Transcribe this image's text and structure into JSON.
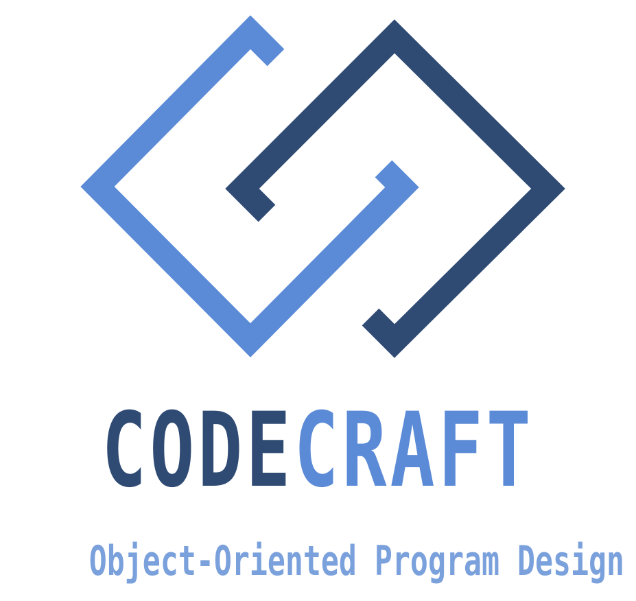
{
  "logo": {
    "name_part1": "CODE",
    "name_part2": "CRAFT",
    "tagline": "Object-Oriented Program Design",
    "mark": "interlocking-brackets-icon",
    "colors": {
      "dark_blue": "#2f4b74",
      "light_blue": "#5b8bd6",
      "tagline_blue": "#7aa1dc"
    }
  }
}
